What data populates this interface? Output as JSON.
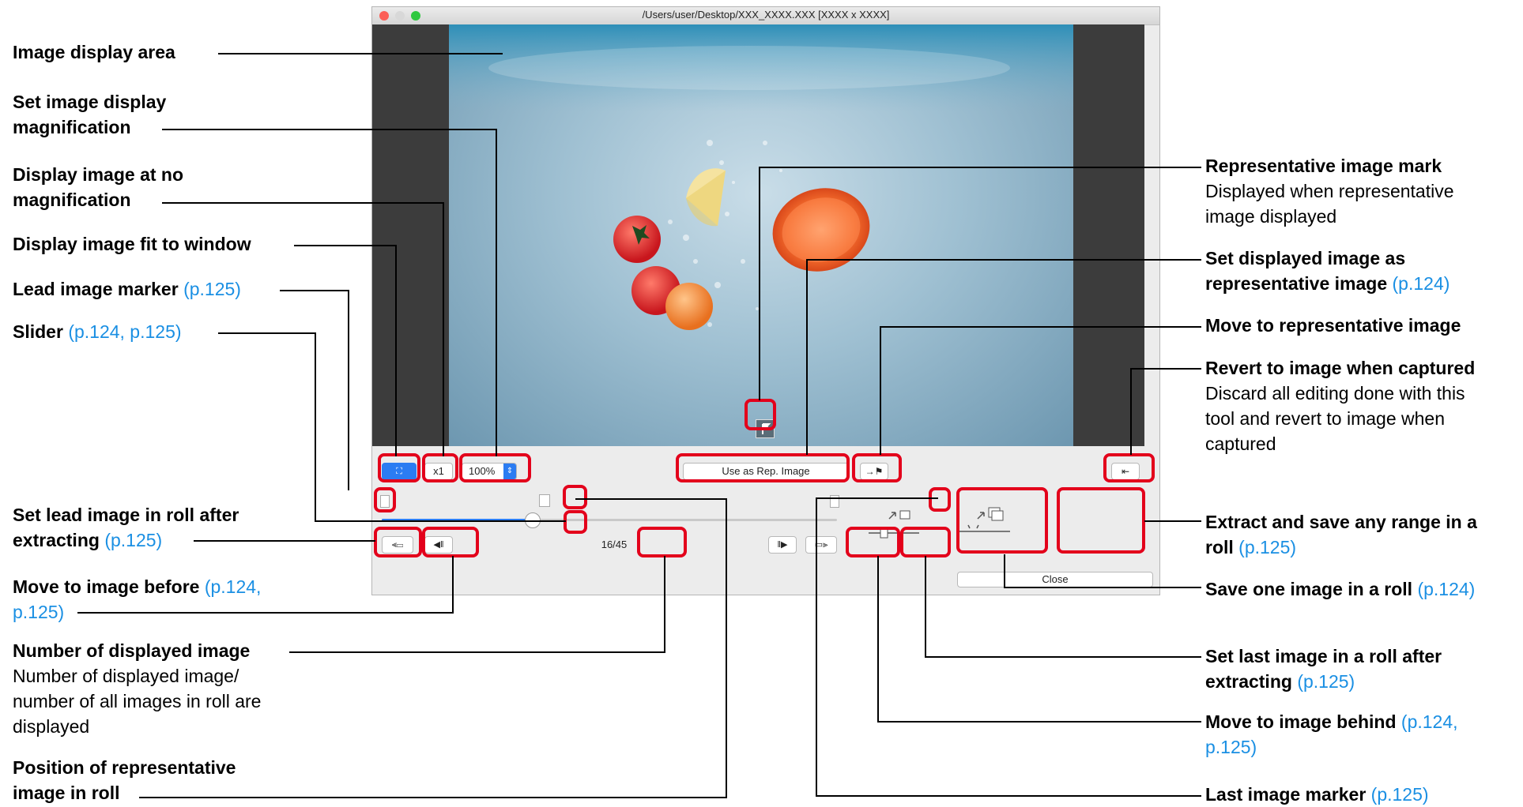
{
  "window": {
    "title": "/Users/user/Desktop/XXX_XXXX.XXX [XXXX x XXXX]",
    "zoom_value": "100%",
    "x1_label": "x1",
    "rep_button_label": "Use as Rep. Image",
    "counter": "16/45",
    "close_label": "Close",
    "slider_progress_fraction": 0.33
  },
  "labels": {
    "image_display_area": "Image display area",
    "set_magnification_1": "Set image display",
    "set_magnification_2": "magnification",
    "no_magnification_1": "Display image at no",
    "no_magnification_2": "magnification",
    "fit_window": "Display image fit to window",
    "lead_marker": "Lead image marker",
    "lead_marker_ref": "(p.125)",
    "slider": "Slider",
    "slider_ref": "(p.124, p.125)",
    "set_lead_1": "Set lead image in roll after",
    "set_lead_2": "extracting",
    "set_lead_ref": "(p.125)",
    "move_before": "Move to image before",
    "move_before_ref_1": "(p.124,",
    "move_before_ref_2": "p.125)",
    "num_displayed": "Number of displayed image",
    "num_displayed_desc_1": "Number of displayed image/",
    "num_displayed_desc_2": "number of all images in roll are",
    "num_displayed_desc_3": "displayed",
    "position_rep_1": "Position of representative",
    "position_rep_2": "image in roll",
    "rep_mark": "Representative image mark",
    "rep_mark_desc_1": "Displayed when representative",
    "rep_mark_desc_2": "image displayed",
    "set_rep_1": "Set displayed image as",
    "set_rep_2": "representative image",
    "set_rep_ref": "(p.124)",
    "move_rep": "Move to representative image",
    "revert": "Revert to image when captured",
    "revert_desc_1": "Discard all editing done with this",
    "revert_desc_2": "tool and revert to image when",
    "revert_desc_3": "captured",
    "extract_range_1": "Extract and save any range in a",
    "extract_range_2": "roll",
    "extract_range_ref": "(p.125)",
    "save_one": "Save one image in a roll",
    "save_one_ref": "(p.124)",
    "set_last_1": "Set last image in a roll after",
    "set_last_2": "extracting",
    "set_last_ref": "(p.125)",
    "move_behind": "Move to image behind",
    "move_behind_ref_1": "(p.124,",
    "move_behind_ref_2": "p.125)",
    "last_marker": "Last image marker",
    "last_marker_ref": "(p.125)"
  },
  "colors": {
    "highlight": "#e3001b",
    "link": "#1a8fe3",
    "accent_button": "#2b7cf2"
  }
}
